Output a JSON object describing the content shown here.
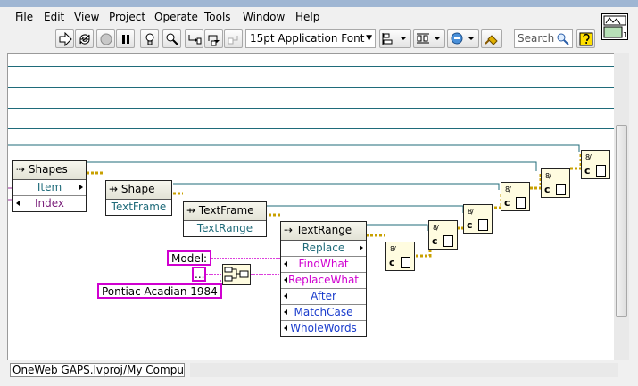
{
  "menu": [
    "File",
    "Edit",
    "View",
    "Project",
    "Operate",
    "Tools",
    "Window",
    "Help"
  ],
  "toolbar": {
    "font": "15pt Application Font",
    "search_placeholder": "Search"
  },
  "diagram": {
    "shapes_node": {
      "title": "Shapes",
      "props": [
        "Item",
        "Index"
      ]
    },
    "shape_node": {
      "title": "Shape",
      "props": [
        "TextFrame"
      ]
    },
    "textframe_node": {
      "title": "TextFrame",
      "props": [
        "TextRange"
      ]
    },
    "textrange_node": {
      "title": "TextRange",
      "props": [
        "Replace",
        "FindWhat",
        "ReplaceWhat",
        "After",
        "MatchCase",
        "WholeWords"
      ]
    },
    "constants": {
      "model": "Model:",
      "ellipsis": "...",
      "value": "Pontiac Acadian 1984"
    },
    "close_label": "c",
    "close_fs": "8/"
  },
  "status": {
    "path": "OneWeb GAPS.lvproj/My Computer"
  },
  "colors": {
    "wire": "#1f6b7a",
    "string": "#d000d0",
    "refnum": "#c8a000"
  }
}
